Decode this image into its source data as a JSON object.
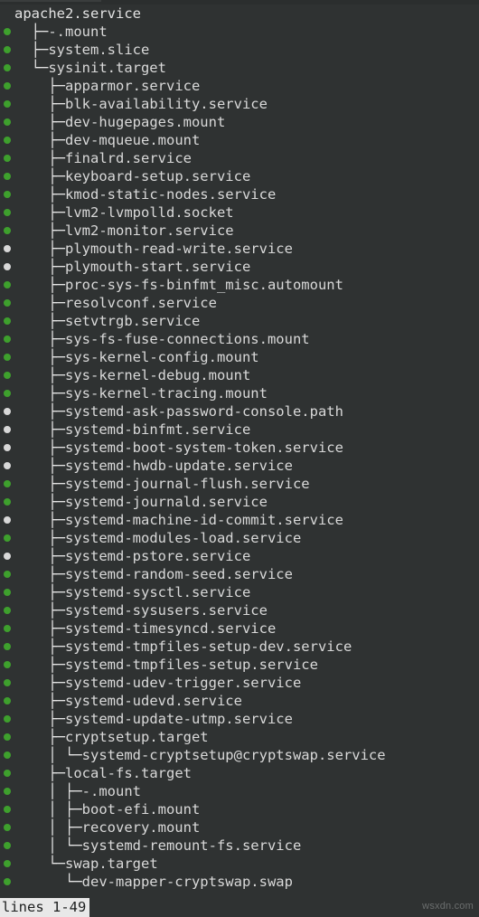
{
  "terminal": {
    "background_color": "#2f3232",
    "foreground_color": "#d4d4d4",
    "active_dot_color": "#3ea02d",
    "inactive_dot_color": "#d8d8d8",
    "status_text": "lines 1-49",
    "watermark": "wsxdn.com"
  },
  "tree": {
    "root": "apache2.service",
    "rows": [
      {
        "dot": "none",
        "prefix": "",
        "name": "apache2.service"
      },
      {
        "dot": "active",
        "prefix": "  ├─",
        "name": "-.mount"
      },
      {
        "dot": "active",
        "prefix": "  ├─",
        "name": "system.slice"
      },
      {
        "dot": "active",
        "prefix": "  └─",
        "name": "sysinit.target"
      },
      {
        "dot": "active",
        "prefix": "    ├─",
        "name": "apparmor.service"
      },
      {
        "dot": "active",
        "prefix": "    ├─",
        "name": "blk-availability.service"
      },
      {
        "dot": "active",
        "prefix": "    ├─",
        "name": "dev-hugepages.mount"
      },
      {
        "dot": "active",
        "prefix": "    ├─",
        "name": "dev-mqueue.mount"
      },
      {
        "dot": "active",
        "prefix": "    ├─",
        "name": "finalrd.service"
      },
      {
        "dot": "active",
        "prefix": "    ├─",
        "name": "keyboard-setup.service"
      },
      {
        "dot": "active",
        "prefix": "    ├─",
        "name": "kmod-static-nodes.service"
      },
      {
        "dot": "active",
        "prefix": "    ├─",
        "name": "lvm2-lvmpolld.socket"
      },
      {
        "dot": "active",
        "prefix": "    ├─",
        "name": "lvm2-monitor.service"
      },
      {
        "dot": "inactive",
        "prefix": "    ├─",
        "name": "plymouth-read-write.service"
      },
      {
        "dot": "inactive",
        "prefix": "    ├─",
        "name": "plymouth-start.service"
      },
      {
        "dot": "active",
        "prefix": "    ├─",
        "name": "proc-sys-fs-binfmt_misc.automount"
      },
      {
        "dot": "active",
        "prefix": "    ├─",
        "name": "resolvconf.service"
      },
      {
        "dot": "active",
        "prefix": "    ├─",
        "name": "setvtrgb.service"
      },
      {
        "dot": "active",
        "prefix": "    ├─",
        "name": "sys-fs-fuse-connections.mount"
      },
      {
        "dot": "active",
        "prefix": "    ├─",
        "name": "sys-kernel-config.mount"
      },
      {
        "dot": "active",
        "prefix": "    ├─",
        "name": "sys-kernel-debug.mount"
      },
      {
        "dot": "active",
        "prefix": "    ├─",
        "name": "sys-kernel-tracing.mount"
      },
      {
        "dot": "inactive",
        "prefix": "    ├─",
        "name": "systemd-ask-password-console.path"
      },
      {
        "dot": "inactive",
        "prefix": "    ├─",
        "name": "systemd-binfmt.service"
      },
      {
        "dot": "inactive",
        "prefix": "    ├─",
        "name": "systemd-boot-system-token.service"
      },
      {
        "dot": "inactive",
        "prefix": "    ├─",
        "name": "systemd-hwdb-update.service"
      },
      {
        "dot": "active",
        "prefix": "    ├─",
        "name": "systemd-journal-flush.service"
      },
      {
        "dot": "active",
        "prefix": "    ├─",
        "name": "systemd-journald.service"
      },
      {
        "dot": "inactive",
        "prefix": "    ├─",
        "name": "systemd-machine-id-commit.service"
      },
      {
        "dot": "active",
        "prefix": "    ├─",
        "name": "systemd-modules-load.service"
      },
      {
        "dot": "inactive",
        "prefix": "    ├─",
        "name": "systemd-pstore.service"
      },
      {
        "dot": "active",
        "prefix": "    ├─",
        "name": "systemd-random-seed.service"
      },
      {
        "dot": "active",
        "prefix": "    ├─",
        "name": "systemd-sysctl.service"
      },
      {
        "dot": "active",
        "prefix": "    ├─",
        "name": "systemd-sysusers.service"
      },
      {
        "dot": "active",
        "prefix": "    ├─",
        "name": "systemd-timesyncd.service"
      },
      {
        "dot": "active",
        "prefix": "    ├─",
        "name": "systemd-tmpfiles-setup-dev.service"
      },
      {
        "dot": "active",
        "prefix": "    ├─",
        "name": "systemd-tmpfiles-setup.service"
      },
      {
        "dot": "active",
        "prefix": "    ├─",
        "name": "systemd-udev-trigger.service"
      },
      {
        "dot": "active",
        "prefix": "    ├─",
        "name": "systemd-udevd.service"
      },
      {
        "dot": "active",
        "prefix": "    ├─",
        "name": "systemd-update-utmp.service"
      },
      {
        "dot": "active",
        "prefix": "    ├─",
        "name": "cryptsetup.target"
      },
      {
        "dot": "active",
        "prefix": "    │ └─",
        "name": "systemd-cryptsetup@cryptswap.service"
      },
      {
        "dot": "active",
        "prefix": "    ├─",
        "name": "local-fs.target"
      },
      {
        "dot": "active",
        "prefix": "    │ ├─",
        "name": "-.mount"
      },
      {
        "dot": "active",
        "prefix": "    │ ├─",
        "name": "boot-efi.mount"
      },
      {
        "dot": "active",
        "prefix": "    │ ├─",
        "name": "recovery.mount"
      },
      {
        "dot": "active",
        "prefix": "    │ └─",
        "name": "systemd-remount-fs.service"
      },
      {
        "dot": "active",
        "prefix": "    └─",
        "name": "swap.target"
      },
      {
        "dot": "active",
        "prefix": "      └─",
        "name": "dev-mapper-cryptswap.swap"
      }
    ]
  }
}
